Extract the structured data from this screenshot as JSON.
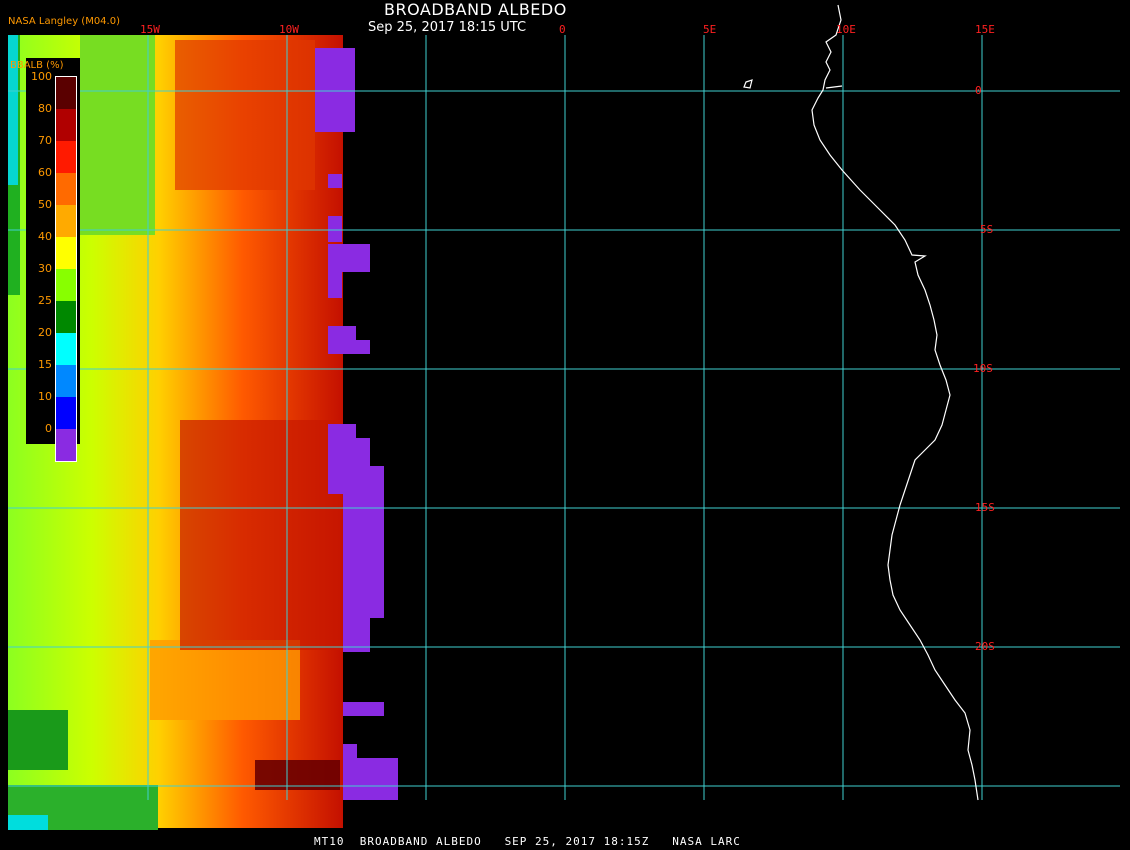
{
  "title": "BROADBAND ALBEDO",
  "subtitle": "Sep 25, 2017 18:15 UTC",
  "credit": "NASA Langley (M04.0)",
  "footer": "MT10  BROADBAND ALBEDO   SEP 25, 2017 18:15Z   NASA LARC",
  "legend": {
    "title": "BBALB (%)",
    "ticks": [
      "100",
      "80",
      "70",
      "60",
      "50",
      "40",
      "30",
      "25",
      "20",
      "15",
      "10",
      "0"
    ],
    "colors": [
      "#5a0000",
      "#b00000",
      "#ff1a00",
      "#ff6a00",
      "#ffaa00",
      "#ffff00",
      "#88ff00",
      "#008800",
      "#00ffff",
      "#0088ff",
      "#0000ff",
      "#8a2be2"
    ]
  },
  "map": {
    "lon_labels": [
      "15W",
      "10W",
      "0",
      "5E",
      "10E",
      "15E"
    ],
    "lat_labels": [
      "0",
      "5S",
      "10S",
      "15S",
      "20S"
    ],
    "grid_color": "#40d0d0",
    "coast_color": "#ffffff"
  }
}
